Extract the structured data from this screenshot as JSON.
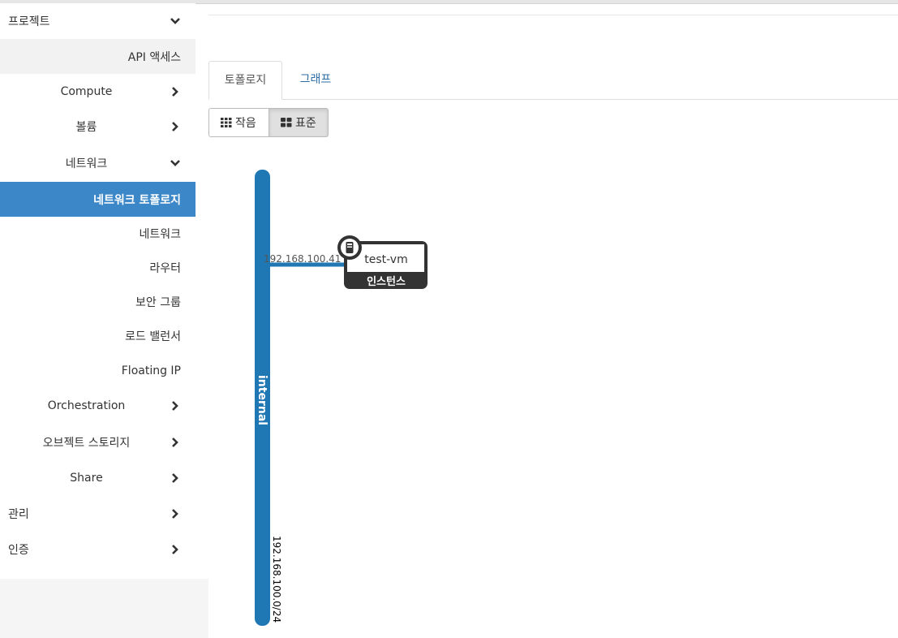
{
  "sidebar": {
    "project": "프로젝트",
    "api_access": "API 액세스",
    "compute": "Compute",
    "volume": "볼륨",
    "network_group": "네트워크",
    "network_topology": "네트워크 토폴로지",
    "networks": "네트워크",
    "routers": "라우터",
    "security_groups": "보안 그룹",
    "load_balancers": "로드 밸런서",
    "floating_ip": "Floating IP",
    "orchestration": "Orchestration",
    "object_storage": "오브젝트 스토리지",
    "share": "Share",
    "admin": "관리",
    "identity": "인증"
  },
  "tabs": {
    "topology": "토폴로지",
    "graph": "그래프"
  },
  "view_buttons": {
    "small": "작음",
    "normal": "표준"
  },
  "topology": {
    "network_name": "internal",
    "network_cidr": "192.168.100.0/24",
    "port_ip": "192.168.100.41",
    "instance_name": "test-vm",
    "instance_type_label": "인스턴스",
    "network_color": "#1f77b4",
    "instance_color": "#333333"
  }
}
